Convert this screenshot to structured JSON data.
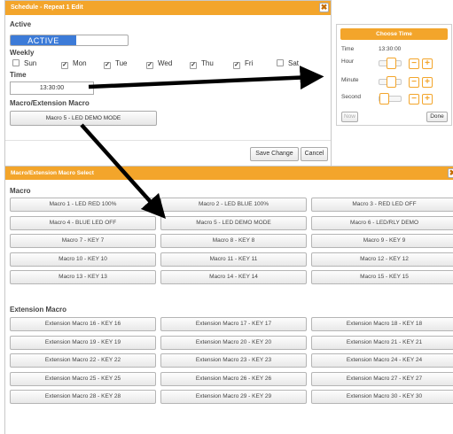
{
  "schedule_dialog": {
    "title": "Schedule - Repeat 1 Edit",
    "close_glyph": "✖",
    "active_label": "Active",
    "active_state": "ACTIVE",
    "weekly_label": "Weekly",
    "days": [
      {
        "label": "Sun",
        "checked": false
      },
      {
        "label": "Mon",
        "checked": true
      },
      {
        "label": "Tue",
        "checked": true
      },
      {
        "label": "Wed",
        "checked": true
      },
      {
        "label": "Thu",
        "checked": true
      },
      {
        "label": "Fri",
        "checked": true
      },
      {
        "label": "Sat",
        "checked": false
      }
    ],
    "time_label": "Time",
    "time_value": "13:30:00",
    "macro_label": "Macro/Extension Macro",
    "macro_value": "Macro 5 - LED DEMO MODE",
    "save_label": "Save Change",
    "cancel_label": "Cancel"
  },
  "time_picker": {
    "header": "Choose Time",
    "time_label": "Time",
    "time_value": "13:30:00",
    "hour_label": "Hour",
    "minute_label": "Minute",
    "second_label": "Second",
    "hour_level": 0.54,
    "minute_level": 0.5,
    "second_level": 0.0,
    "minus_glyph": "−",
    "plus_glyph": "+",
    "now_label": "Now",
    "done_label": "Done"
  },
  "macro_dialog": {
    "title": "Macro/Extension Macro Select",
    "macro_section_label": "Macro",
    "macros": [
      "Macro 1 - LED RED 100%",
      "Macro 2 - LED BLUE 100%",
      "Macro 3 - RED LED OFF",
      "Macro 4 - BLUE LED OFF",
      "Macro 5 - LED DEMO MODE",
      "Macro 6 - LED/RLY DEMO",
      "Macro 7 - KEY 7",
      "Macro 8 - KEY 8",
      "Macro 9 - KEY 9",
      "Macro 10 - KEY 10",
      "Macro 11 - KEY 11",
      "Macro 12 - KEY 12",
      "Macro 13 - KEY 13",
      "Macro 14 - KEY 14",
      "Macro 15 - KEY 15"
    ],
    "extension_section_label": "Extension Macro",
    "extension_macros": [
      "Extension Macro 16 - KEY 16",
      "Extension Macro 17 - KEY 17",
      "Extension Macro 18 - KEY 18",
      "Extension Macro 19 - KEY 19",
      "Extension Macro 20 - KEY 20",
      "Extension Macro 21 - KEY 21",
      "Extension Macro 22 - KEY 22",
      "Extension Macro 23 - KEY 23",
      "Extension Macro 24 - KEY 24",
      "Extension Macro 25 - KEY 25",
      "Extension Macro 26 - KEY 26",
      "Extension Macro 27 - KEY 27",
      "Extension Macro 28 - KEY 28",
      "Extension Macro 29 - KEY 29",
      "Extension Macro 30 - KEY 30"
    ]
  },
  "colors": {
    "title_bar": "#f3a52b",
    "active_toggle": "#3c7bd8",
    "arrow": "#000000"
  }
}
